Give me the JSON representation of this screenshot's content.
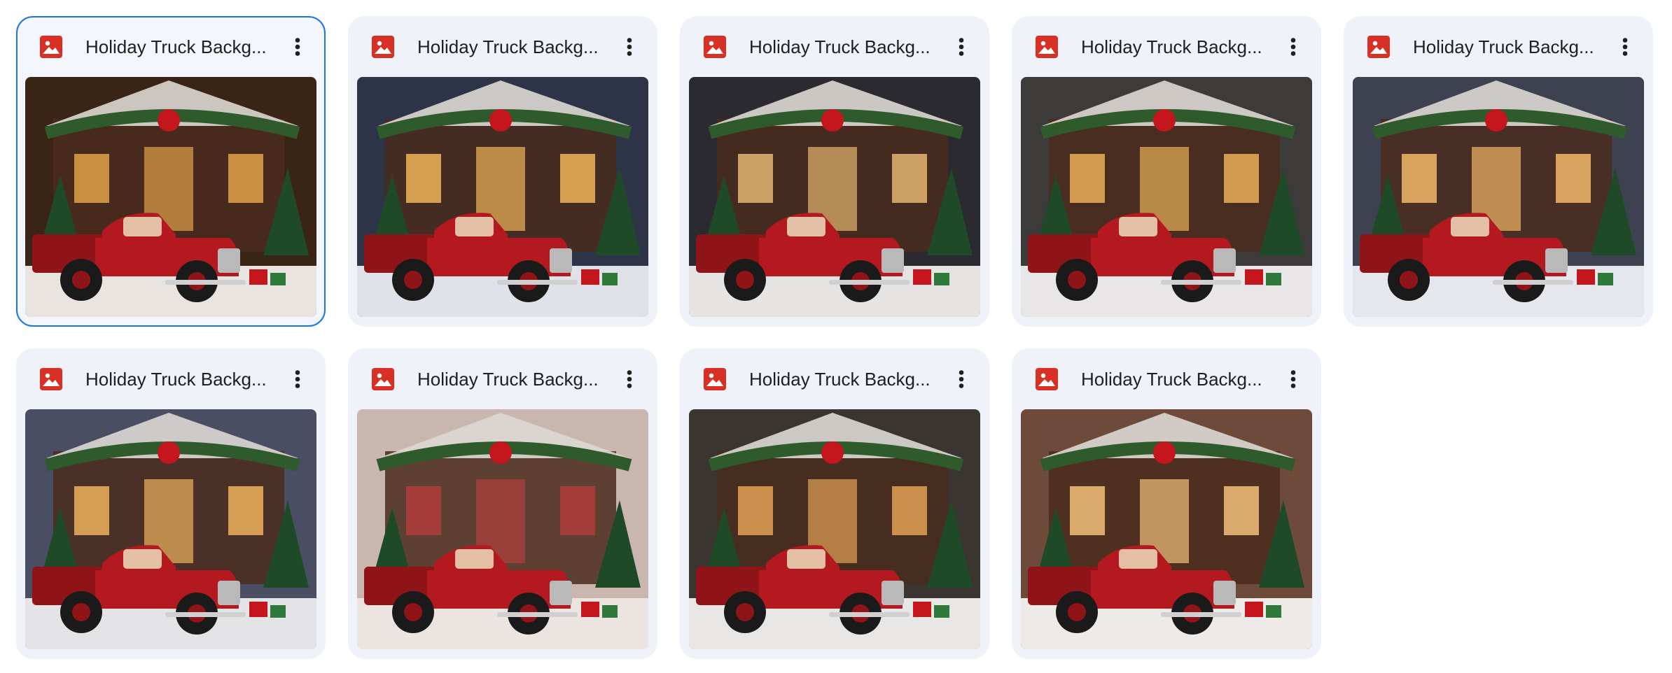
{
  "files": [
    {
      "name": "Holiday Truck Backg...",
      "icon": "image-file-icon",
      "selected": true,
      "sky": "#3a2416",
      "glow": "#e0a24a",
      "snow": "#e9e4e0"
    },
    {
      "name": "Holiday Truck Backg...",
      "icon": "image-file-icon",
      "selected": false,
      "sky": "#2d3447",
      "glow": "#f0b357",
      "snow": "#dfe2e8"
    },
    {
      "name": "Holiday Truck Backg...",
      "icon": "image-file-icon",
      "selected": false,
      "sky": "#2a2a30",
      "glow": "#e5b671",
      "snow": "#e6e4e2"
    },
    {
      "name": "Holiday Truck Backg...",
      "icon": "image-file-icon",
      "selected": false,
      "sky": "#3d3a3a",
      "glow": "#eab05a",
      "snow": "#e8e6e6"
    },
    {
      "name": "Holiday Truck Backg...",
      "icon": "image-file-icon",
      "selected": false,
      "sky": "#3e4150",
      "glow": "#f2b766",
      "snow": "#e5e7ec"
    },
    {
      "name": "Holiday Truck Backg...",
      "icon": "image-file-icon",
      "selected": false,
      "sky": "#4a4e63",
      "glow": "#eeb25c",
      "snow": "#e4e3e6"
    },
    {
      "name": "Holiday Truck Backg...",
      "icon": "image-file-icon",
      "selected": false,
      "sky": "#c9b6ae",
      "glow": "#b23e3c",
      "snow": "#ece4e0"
    },
    {
      "name": "Holiday Truck Backg...",
      "icon": "image-file-icon",
      "selected": false,
      "sky": "#3a3530",
      "glow": "#e2a255",
      "snow": "#e9e7e5"
    },
    {
      "name": "Holiday Truck Backg...",
      "icon": "image-file-icon",
      "selected": false,
      "sky": "#6e4a3a",
      "glow": "#f1c07a",
      "snow": "#eeeae8"
    }
  ],
  "menu_icon": "more-vert-icon",
  "colors": {
    "card_bg": "#eff3f9",
    "selected_border": "#1a73e8",
    "image_icon_red": "#d93025",
    "truck_red": "#b3191f"
  }
}
